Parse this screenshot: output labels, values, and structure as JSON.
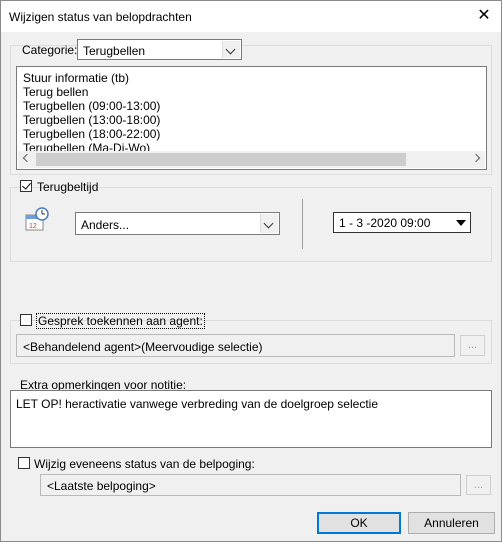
{
  "window": {
    "title": "Wijzigen status van belopdrachten",
    "close_glyph": "✕"
  },
  "category": {
    "label": "Categorie:",
    "value": "Terugbellen",
    "items": [
      "Stuur informatie (tb)",
      "Terug bellen",
      "Terugbellen (09:00-13:00)",
      "Terugbellen (13:00-18:00)",
      "Terugbellen (18:00-22:00)",
      "Terugbellen (Ma-Di-Wo)"
    ]
  },
  "callback": {
    "checkbox_label": "Terugbeltijd",
    "checked": true,
    "icon": "calendar-clock-icon",
    "option_value": "Anders...",
    "datetime_value": "1 - 3 -2020 09:00"
  },
  "agent": {
    "checkbox_label": "Gesprek toekennen aan agent:",
    "checked": false,
    "field_value": "<Behandelend agent>(Meervoudige selectie)",
    "browse_label": "..."
  },
  "remarks": {
    "label": "Extra opmerkingen voor notitie:",
    "text": "LET OP! heractivatie vanwege verbreding van de doelgroep selectie"
  },
  "attempt": {
    "checkbox_label": "Wijzig eveneens status van de belpoging:",
    "checked": false,
    "field_value": "<Laatste belpoging>",
    "browse_label": "..."
  },
  "buttons": {
    "ok": "OK",
    "cancel": "Annuleren"
  },
  "colors": {
    "default_button_border": "#0078d7",
    "window_bg": "#f0f0f0"
  }
}
